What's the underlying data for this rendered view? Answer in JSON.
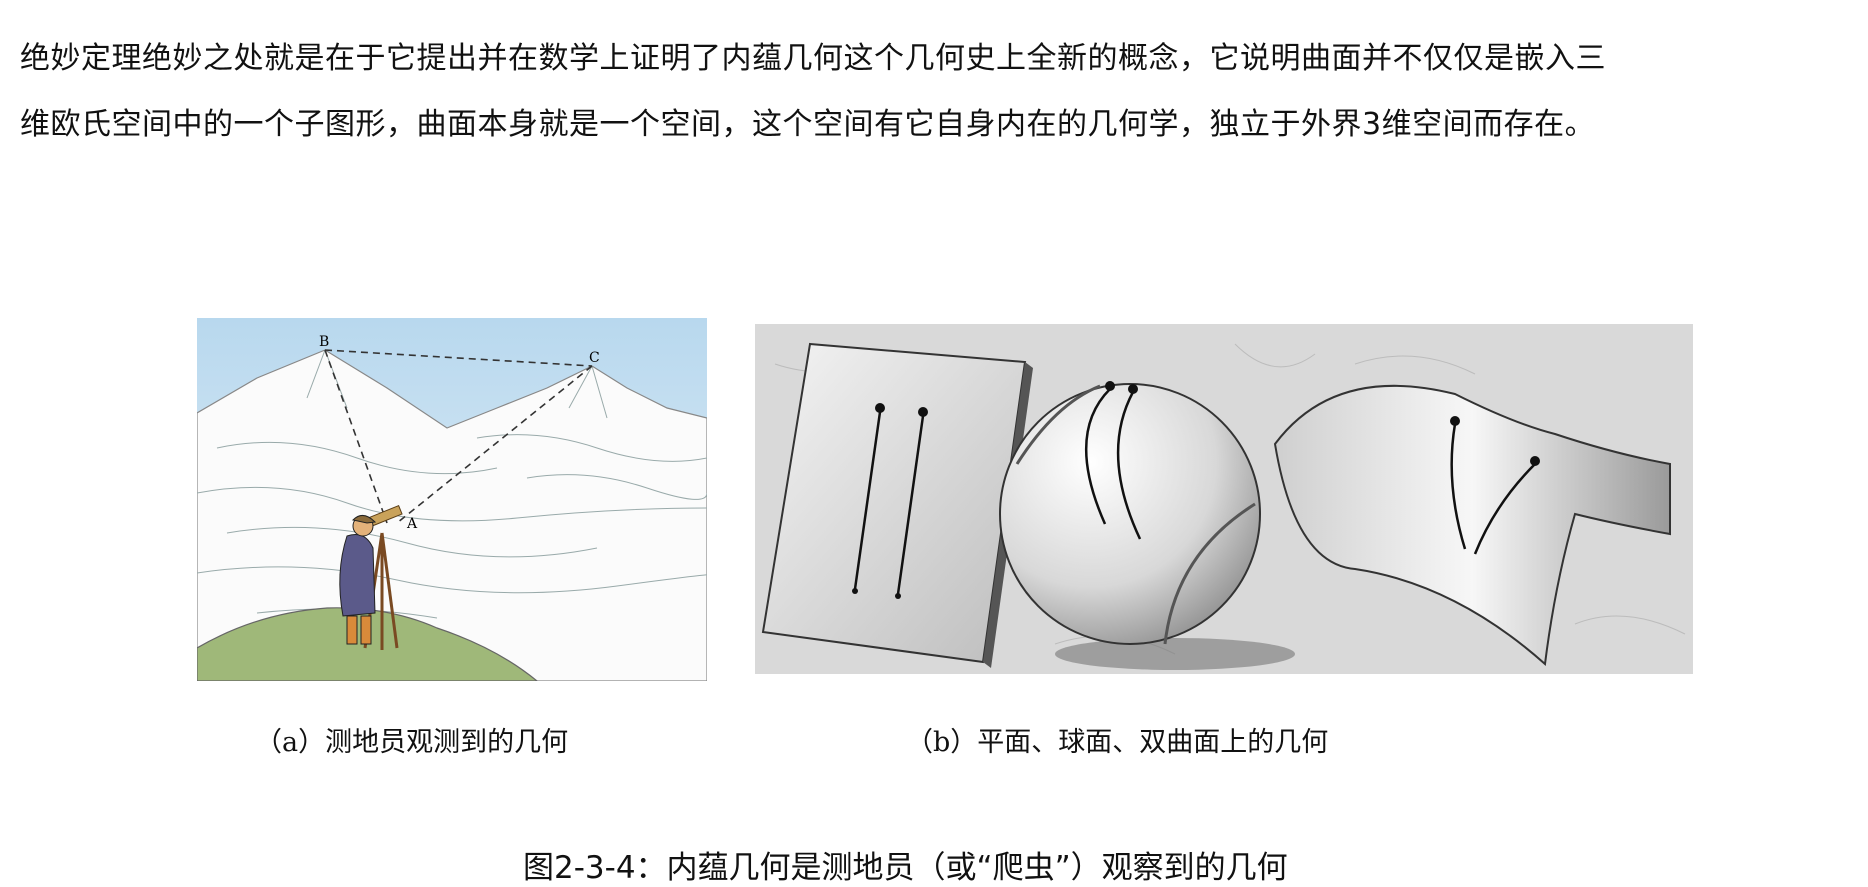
{
  "paragraph": {
    "line1": "绝妙定理绝妙之处就是在于它提出并在数学上证明了内蕴几何这个几何史上全新的概念，它说明曲面并不仅仅是嵌入三",
    "line2": "维欧氏空间中的一个子图形，曲面本身就是一个空间，这个空间有它自身内在的几何学，独立于外界3维空间而存在。"
  },
  "figure": {
    "panel_a": {
      "point_labels": [
        "B",
        "C",
        "A"
      ],
      "caption": "（a）测地员观测到的几何"
    },
    "panel_b": {
      "caption": "（b）平面、球面、双曲面上的几何"
    },
    "caption": "图2-3-4：内蕴几何是测地员（或“爬虫”）观察到的几何"
  }
}
